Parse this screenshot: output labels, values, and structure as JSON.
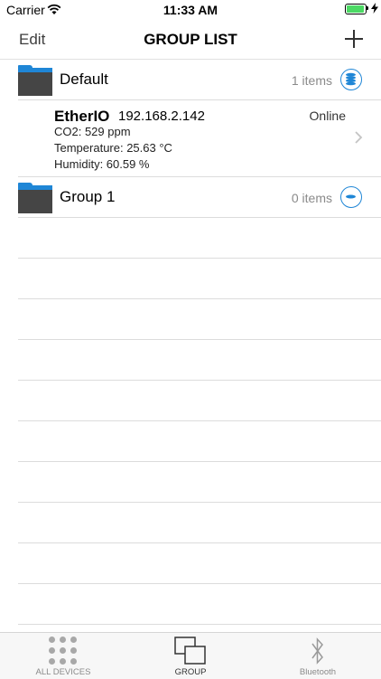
{
  "status_bar": {
    "carrier": "Carrier",
    "time": "11:33 AM",
    "battery_level": 0.95
  },
  "nav": {
    "edit_label": "Edit",
    "title": "GROUP LIST"
  },
  "groups": [
    {
      "name": "Default",
      "count": "1 items"
    },
    {
      "name": "Group 1",
      "count": "0 items"
    }
  ],
  "device": {
    "name": "EtherIO",
    "ip": "192.168.2.142",
    "status": "Online",
    "co2": "CO2:   529   ppm",
    "temperature": "Temperature:   25.63   °C",
    "humidity": "Humidity:   60.59   %"
  },
  "tabs": [
    {
      "label": "ALL DEVICES",
      "icon": "grid-icon"
    },
    {
      "label": "GROUP",
      "icon": "group-icon"
    },
    {
      "label": "Bluetooth",
      "icon": "bluetooth-icon"
    }
  ],
  "colors": {
    "accent": "#1f86d6",
    "folder_body": "#454545",
    "online_battery": "#4cd964"
  }
}
